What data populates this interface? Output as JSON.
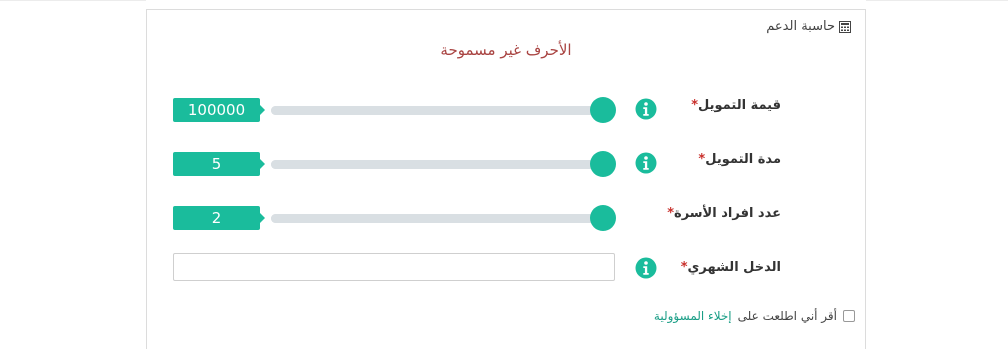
{
  "panel": {
    "title": "حاسبة الدعم",
    "error_message": "الأحرف غير مسموحة"
  },
  "fields": {
    "financing_amount": {
      "label": "قيمة التمويل",
      "value": "100000",
      "level": 1.0
    },
    "financing_duration": {
      "label": "مدة التمويل",
      "value": "5",
      "level": 1.0
    },
    "family_members": {
      "label": "عدد افراد الأسرة",
      "value": "2",
      "level": 1.0
    },
    "monthly_income": {
      "label": "الدخل الشهري",
      "value": "",
      "placeholder": ""
    },
    "required_mark": "*"
  },
  "consent": {
    "text": "أقر أني اطلعت على",
    "link": "إخلاء المسؤولية",
    "checked": false
  },
  "colors": {
    "accent": "#1abc9c",
    "error": "#a94442",
    "required": "#c9302c",
    "track": "#d9dfe3"
  }
}
